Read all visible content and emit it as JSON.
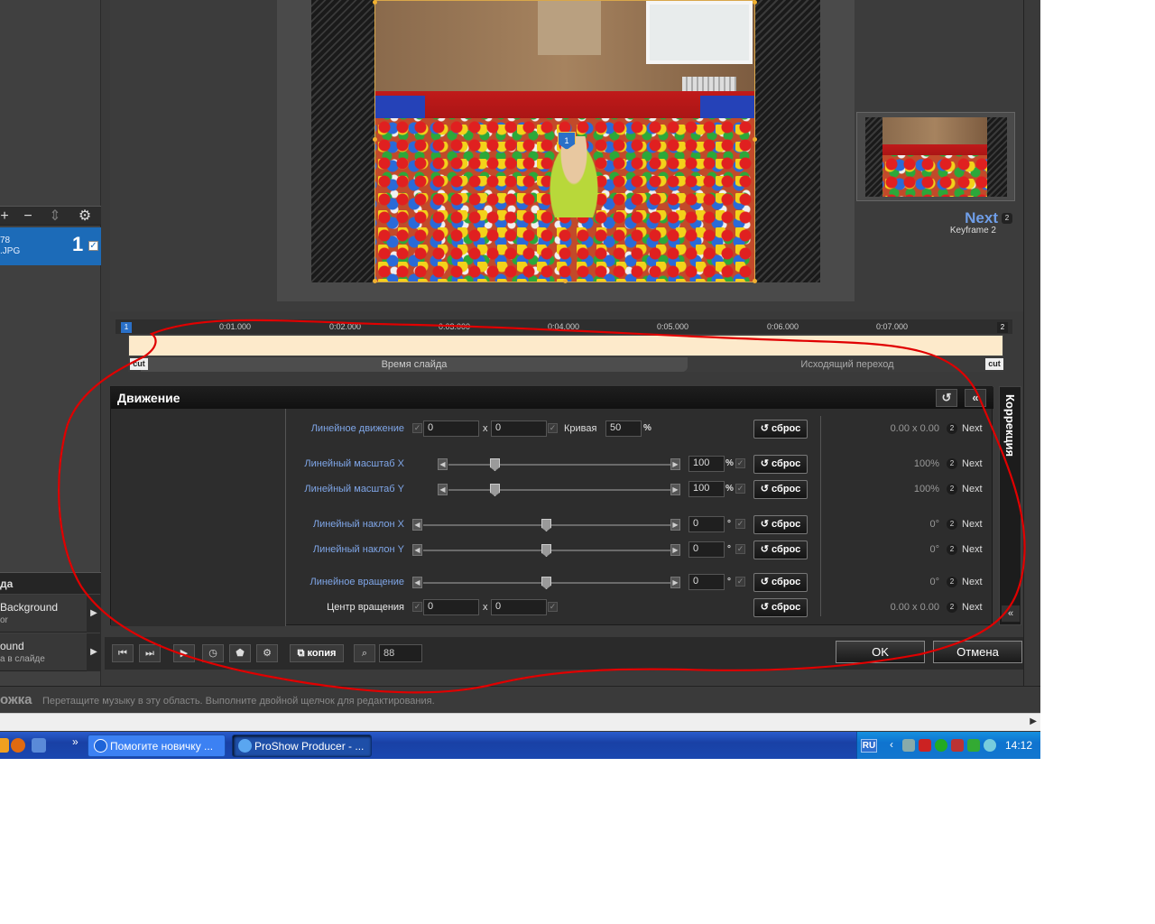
{
  "left_panel": {
    "toolbar": {
      "add": "+",
      "remove": "−",
      "updown": "⇕",
      "settings": "⚙"
    },
    "layer": {
      "line1": "78",
      "line2": ".JPG",
      "number": "1",
      "checked": "✓"
    },
    "section_title": "да",
    "background_items": [
      {
        "title": "Background",
        "subtitle": "or"
      },
      {
        "title": "ound",
        "subtitle": "а в слайде"
      }
    ]
  },
  "preview": {
    "keyframe_marker": "1",
    "next": {
      "label": "Next",
      "badge": "2",
      "keyframe": "Keyframe 2"
    }
  },
  "timeline": {
    "start_flag": "1",
    "end_flag": "2",
    "ticks": [
      "0:01.000",
      "0:02.000",
      "0:03.000",
      "0:04.000",
      "0:05.000",
      "0:06.000",
      "0:07.000"
    ],
    "slide_time_label": "Время слайда",
    "out_transition_label": "Исходящий переход",
    "cut_label": "cut"
  },
  "motion_panel": {
    "title": "Движение",
    "side_tab": "Коррекция",
    "rows": [
      {
        "label": "Линейное движение",
        "x": "0",
        "y": "0",
        "curve_label": "Кривая",
        "curve": "50",
        "unit": "%",
        "reset": "сброс",
        "kf_value": "0.00 x 0.00",
        "kf_badge": "2",
        "kf_next": "Next"
      },
      {
        "label": "Линейный масштаб X",
        "value": "100",
        "unit": "%",
        "slider": 0.2,
        "reset": "сброс",
        "kf_value": "100%",
        "kf_badge": "2",
        "kf_next": "Next"
      },
      {
        "label": "Линейный масштаб Y",
        "value": "100",
        "unit": "%",
        "slider": 0.2,
        "reset": "сброс",
        "kf_value": "100%",
        "kf_badge": "2",
        "kf_next": "Next"
      },
      {
        "label": "Линейный наклон X",
        "value": "0",
        "unit": "°",
        "slider": 0.5,
        "reset": "сброс",
        "kf_value": "0°",
        "kf_badge": "2",
        "kf_next": "Next"
      },
      {
        "label": "Линейный наклон Y",
        "value": "0",
        "unit": "°",
        "slider": 0.5,
        "reset": "сброс",
        "kf_value": "0°",
        "kf_badge": "2",
        "kf_next": "Next"
      },
      {
        "label": "Линейное вращение",
        "value": "0",
        "unit": "°",
        "slider": 0.5,
        "reset": "сброс",
        "kf_value": "0°",
        "kf_badge": "2",
        "kf_next": "Next"
      },
      {
        "label": "Центр вращения",
        "x": "0",
        "y": "0",
        "reset": "сброс",
        "kf_value": "0.00 x 0.00",
        "kf_badge": "2",
        "kf_next": "Next"
      }
    ],
    "x_sep": "x"
  },
  "bottom_bar": {
    "copy": "копия",
    "zoom": "88",
    "ok": "OK",
    "cancel": "Отмена"
  },
  "audio": {
    "title": "ожка",
    "hint": "Перетащите музыку в эту область. Выполните двойной щелчок для редактирования."
  },
  "taskbar": {
    "tasks": [
      "Помогите новичку ...",
      "ProShow Producer - ..."
    ],
    "chevron": "»",
    "lang": "RU",
    "clock": "14:12"
  },
  "colors": {
    "accent": "#1c6bb8",
    "label_blue": "#7fa6e8",
    "annotation_red": "#e00000",
    "timeline_bar": "#fdeacb"
  }
}
